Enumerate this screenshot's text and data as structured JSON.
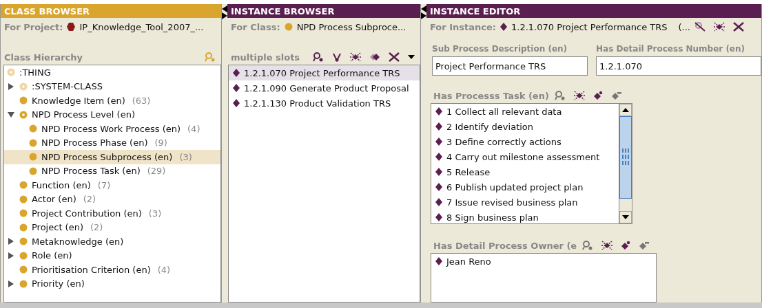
{
  "class_browser": {
    "title": "CLASS BROWSER",
    "for_label": "For Project:",
    "project_name": "IP_Knowledge_Tool_2007_...",
    "hierarchy_label": "Class Hierarchy",
    "tree": [
      {
        "label": ":THING",
        "kind": "system",
        "selected": false,
        "children": [
          {
            "label": ":SYSTEM-CLASS",
            "kind": "system",
            "expanded": false,
            "selected": false
          },
          {
            "label": "Knowledge Item (en)",
            "count": "(63)",
            "kind": "concrete",
            "selected": false
          },
          {
            "label": "NPD Process Level (en)",
            "kind": "abstract",
            "expanded": true,
            "selected": false,
            "children": [
              {
                "label": "NPD Process Work Process (en)",
                "count": "(4)",
                "kind": "concrete",
                "selected": false
              },
              {
                "label": "NPD Process Phase (en)",
                "count": "(9)",
                "kind": "concrete",
                "selected": false
              },
              {
                "label": "NPD Process Subprocess (en)",
                "count": "(3)",
                "kind": "concrete",
                "selected": true
              },
              {
                "label": "NPD Process Task (en)",
                "count": "(29)",
                "kind": "concrete",
                "selected": false
              }
            ]
          },
          {
            "label": "Function (en)",
            "count": "(7)",
            "kind": "concrete",
            "selected": false
          },
          {
            "label": "Actor (en)",
            "count": "(2)",
            "kind": "concrete",
            "selected": false
          },
          {
            "label": "Project Contribution (en)",
            "count": "(3)",
            "kind": "concrete",
            "selected": false
          },
          {
            "label": "Project (en)",
            "count": "(2)",
            "kind": "concrete",
            "selected": false
          },
          {
            "label": "Metaknowledge (en)",
            "kind": "concrete",
            "expanded": false,
            "selected": false
          },
          {
            "label": "Role (en)",
            "kind": "concrete",
            "expanded": false,
            "selected": false
          },
          {
            "label": "Prioritisation Criterion (en)",
            "count": "(4)",
            "kind": "concrete",
            "selected": false
          },
          {
            "label": "Priority (en)",
            "kind": "concrete",
            "expanded": false,
            "selected": false
          }
        ]
      }
    ]
  },
  "instance_browser": {
    "title": "INSTANCE BROWSER",
    "for_label": "For Class:",
    "class_name": "NPD Process Subproce...",
    "slots_label": "multiple slots",
    "instances": [
      {
        "label": "1.2.1.070 Project Performance TRS",
        "selected": true
      },
      {
        "label": "1.2.1.090 Generate Product Proposal",
        "selected": false
      },
      {
        "label": "1.2.1.130 Product Validation TRS",
        "selected": false
      }
    ]
  },
  "instance_editor": {
    "title": "INSTANCE EDITOR",
    "for_label": "For Instance:",
    "instance_name": "1.2.1.070 Project Performance TRS",
    "instance_suffix": "(...",
    "fields": [
      {
        "label": "Sub Process Description (en)",
        "value": "Project Performance TRS"
      },
      {
        "label": "Has Detail Process Number (en)",
        "value": "1.2.1.070"
      }
    ],
    "task_list": {
      "label": "Has Processs Task (en)",
      "items": [
        "1 Collect all relevant data",
        "2 Identify deviation",
        "3 Define correctly actions",
        "4 Carry out milestone assessment",
        "5 Release",
        "6 Publish updated project plan",
        "7 Issue revised business plan",
        "8 Sign business plan"
      ]
    },
    "owner_list": {
      "label": "Has Detail Process Owner (e",
      "items": [
        "Jean Reno"
      ]
    }
  }
}
